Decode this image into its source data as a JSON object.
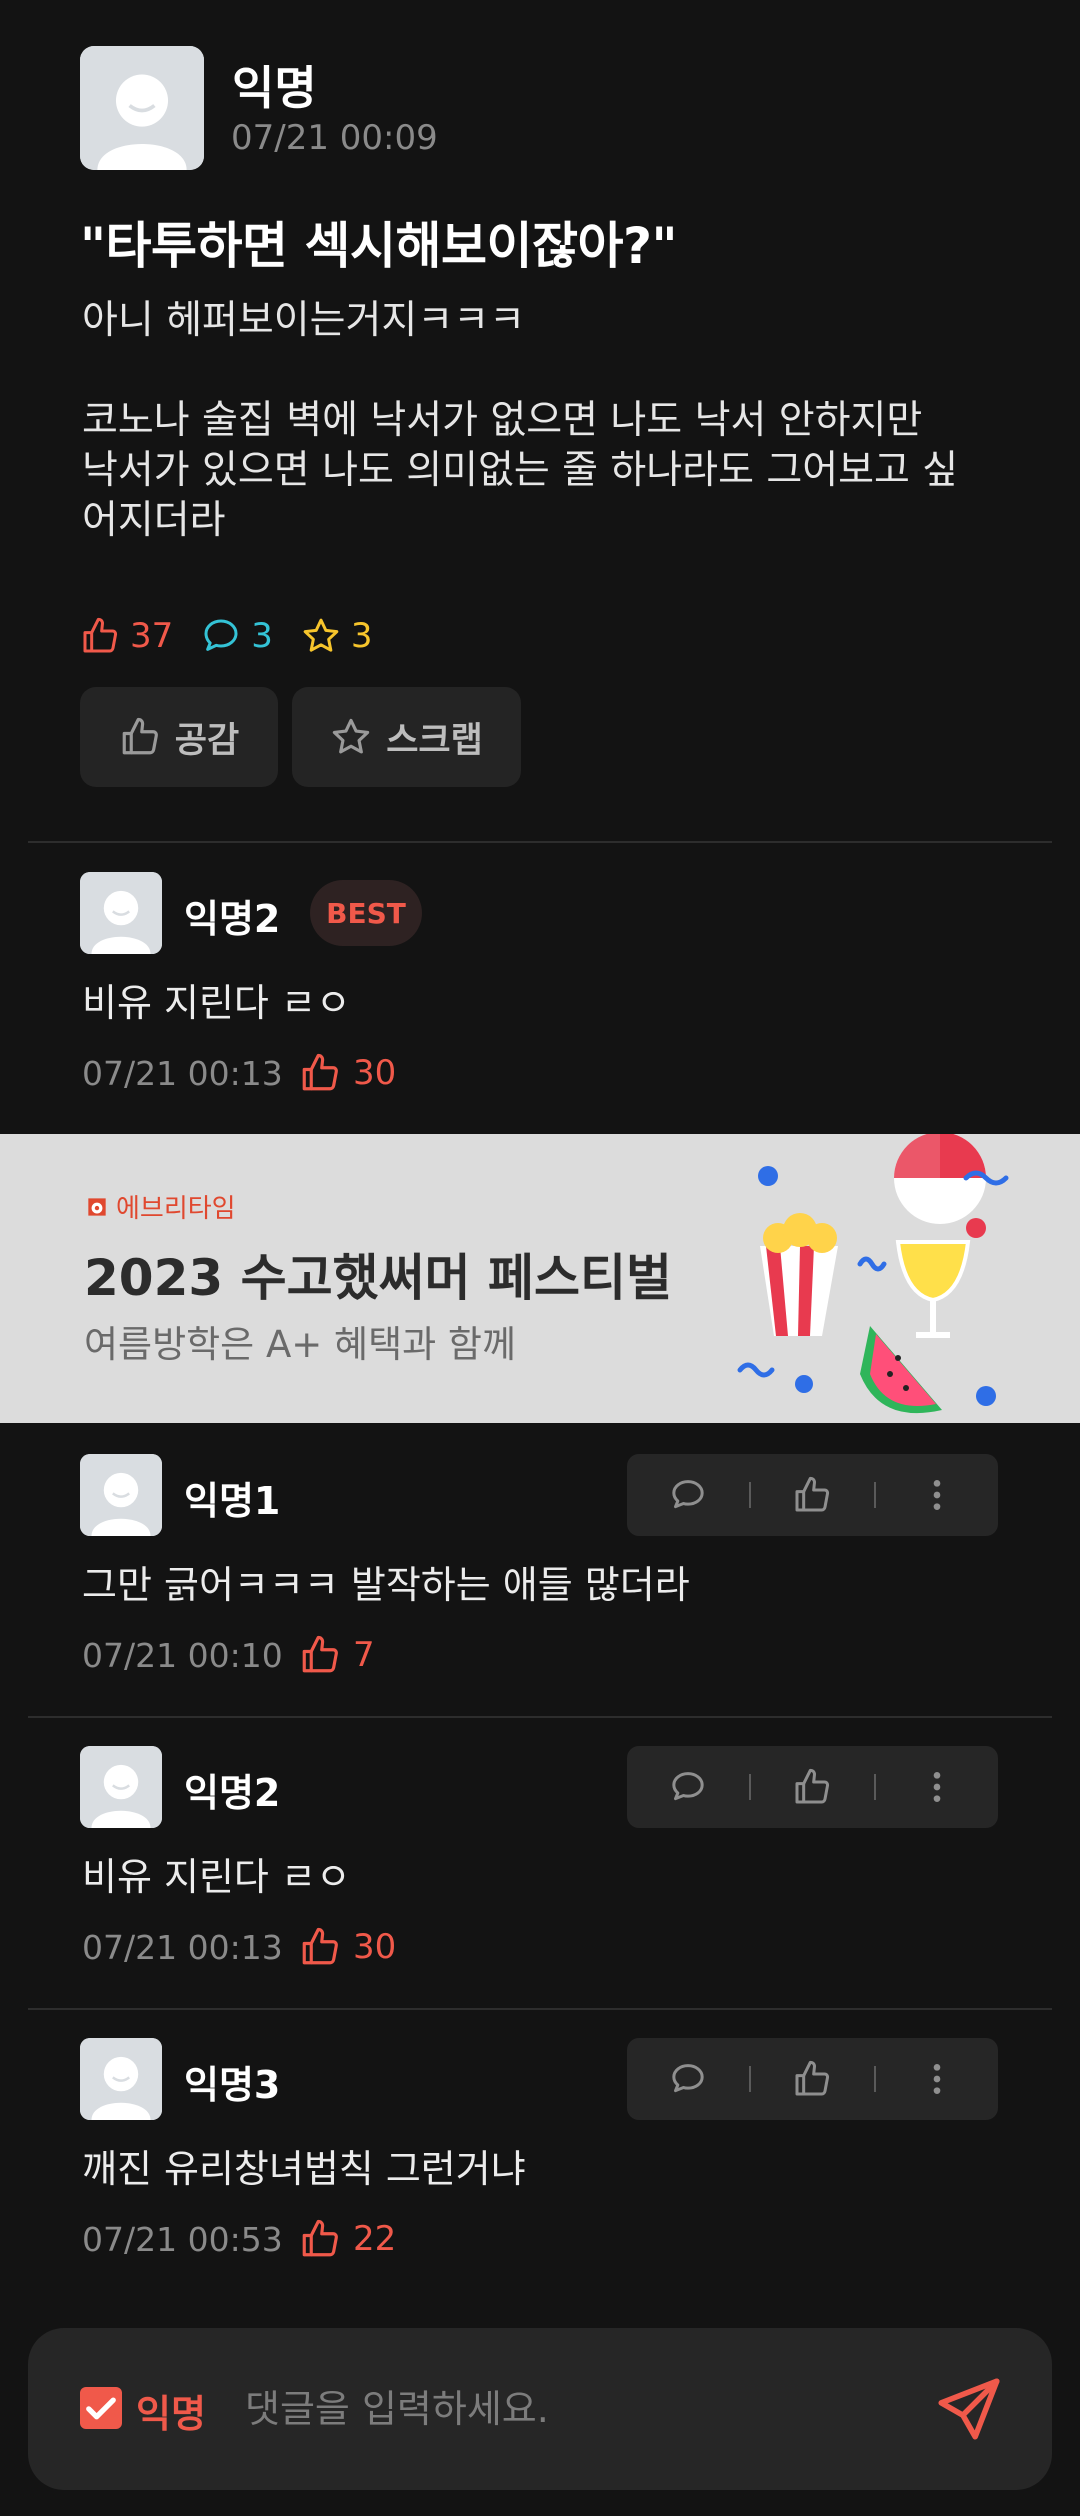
{
  "post": {
    "author": "익명",
    "time": "07/21 00:09",
    "title": "\"타투하면 섹시해보이잖아?\"",
    "body": "아니 헤퍼보이는거지ㅋㅋㅋ\n\n코노나 술집 벽에 낙서가 없으면 나도 낙서 안하지만\n낙서가 있으면 나도 의미없는 줄 하나라도 그어보고 싶\n어지더라",
    "likes": "37",
    "comments": "3",
    "scraps": "3",
    "like_button": "공감",
    "scrap_button": "스크랩"
  },
  "best_comment": {
    "author": "익명2",
    "badge": "BEST",
    "text": "비유 지린다 ㄹㅇ",
    "time": "07/21 00:13",
    "likes": "30"
  },
  "ad": {
    "brand": "에브리타임",
    "title": "2023 수고했써머 페스티벌",
    "subtitle": "여름방학은 A+ 혜택과 함께"
  },
  "comments": [
    {
      "author": "익명1",
      "text": "그만 긁어ㅋㅋㅋ 발작하는 애들 많더라",
      "time": "07/21 00:10",
      "likes": "7"
    },
    {
      "author": "익명2",
      "text": "비유 지린다 ㄹㅇ",
      "time": "07/21 00:13",
      "likes": "30"
    },
    {
      "author": "익명3",
      "text": "깨진 유리창녀법칙 그런거냐",
      "time": "07/21 00:53",
      "likes": "22"
    }
  ],
  "input": {
    "anonymous_label": "익명",
    "anonymous_checked": true,
    "placeholder": "댓글을 입력하세요."
  },
  "colors": {
    "accent": "#f0594a",
    "comment_icon": "#34c3d6",
    "scrap_icon": "#f7c52c",
    "background": "#131313"
  }
}
